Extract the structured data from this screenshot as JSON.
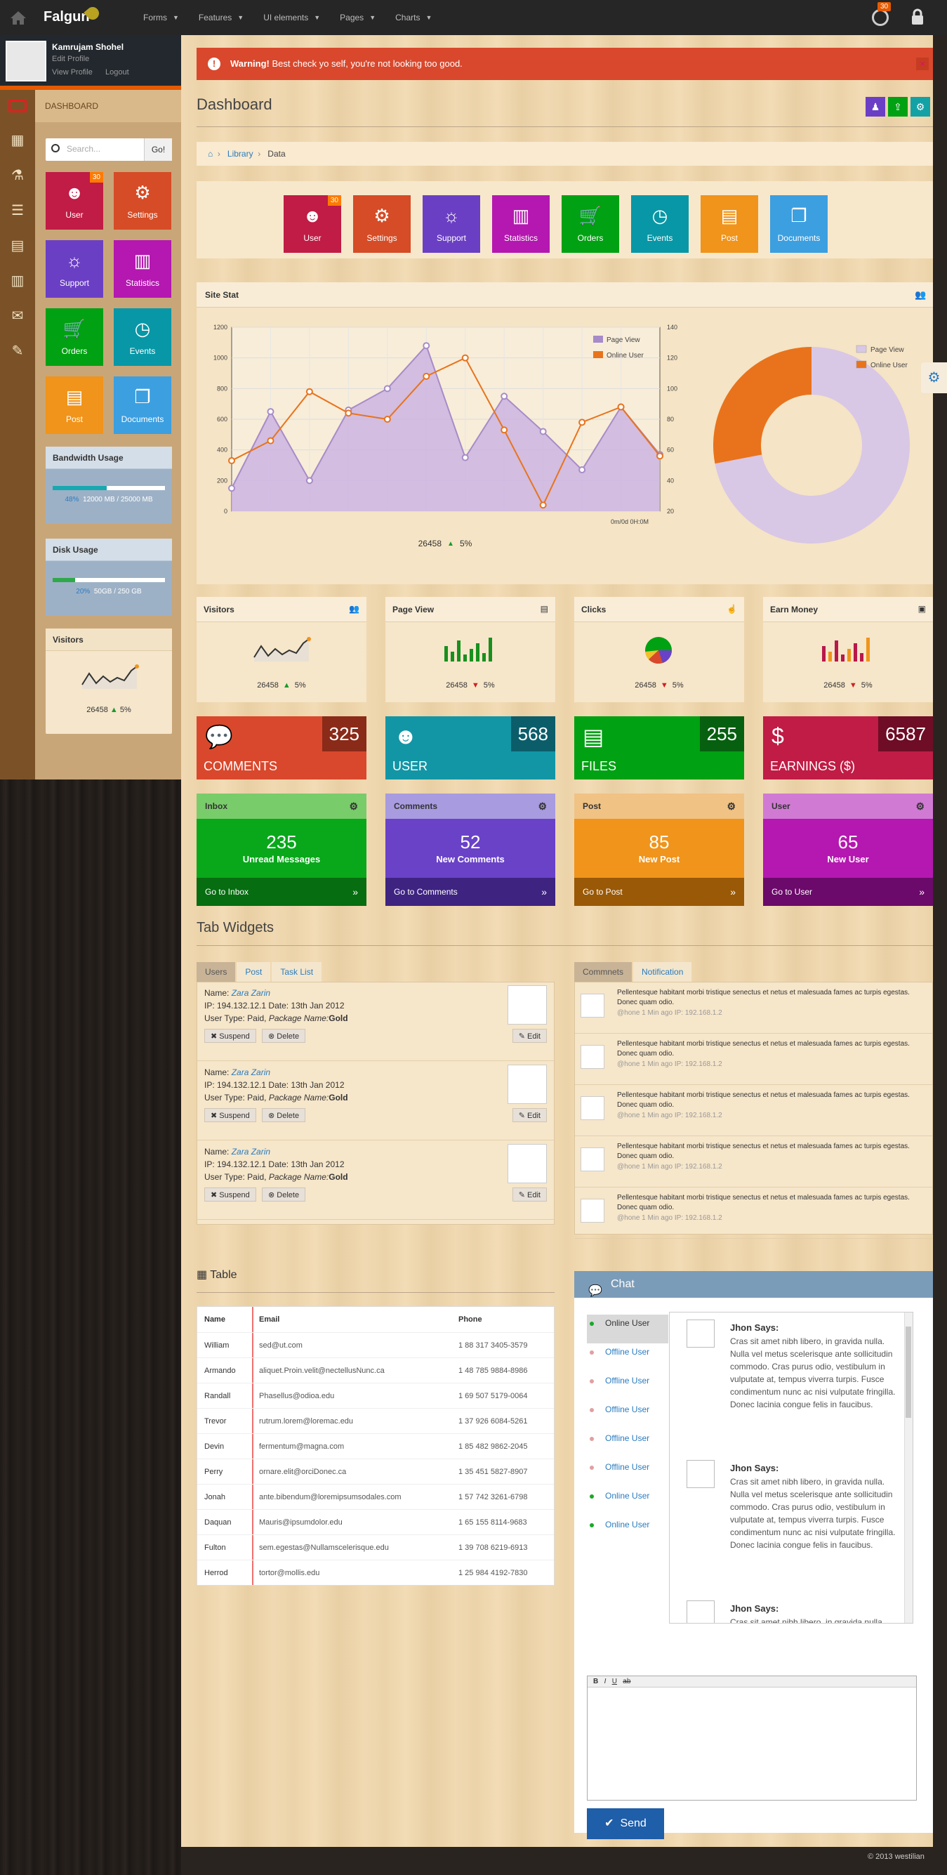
{
  "brand": "Falgun",
  "topnav": {
    "items": [
      "Forms",
      "Features",
      "UI elements",
      "Pages",
      "Charts"
    ],
    "notify_badge": "30"
  },
  "profile": {
    "name": "Kamrujam Shohel",
    "edit": "Edit Profile",
    "view": "View Profile",
    "logout": "Logout"
  },
  "sidebar": {
    "dashboard_label": "DASHBOARD",
    "search_placeholder": "Search...",
    "go": "Go!",
    "tiles": [
      {
        "label": "User",
        "badge": "30",
        "color": "#c01c45"
      },
      {
        "label": "Settings",
        "color": "#d54c26"
      },
      {
        "label": "Support",
        "color": "#6b3fc4"
      },
      {
        "label": "Statistics",
        "color": "#b418b0"
      },
      {
        "label": "Orders",
        "color": "#00a112"
      },
      {
        "label": "Events",
        "color": "#0897a6"
      },
      {
        "label": "Post",
        "color": "#f0941b"
      },
      {
        "label": "Documents",
        "color": "#3c9fe0"
      }
    ],
    "bandwidth": {
      "title": "Bandwidth Usage",
      "percent": "48%",
      "text": "12000 MB / 25000 MB",
      "fill": 0.48
    },
    "disk": {
      "title": "Disk Usage",
      "percent": "20%",
      "text": "50GB / 250 GB",
      "fill": 0.2
    },
    "visitors": {
      "title": "Visitors",
      "value": "26458",
      "pct": "5%"
    }
  },
  "warning": {
    "strong": "Warning!",
    "text": "Best check yo self, you're not looking too good."
  },
  "page_title": "Dashboard",
  "breadcrumb": {
    "library": "Library",
    "data": "Data"
  },
  "quick_tiles": [
    {
      "label": "User",
      "badge": "30",
      "color": "#c01c45"
    },
    {
      "label": "Settings",
      "color": "#d54c26"
    },
    {
      "label": "Support",
      "color": "#6b3fc4"
    },
    {
      "label": "Statistics",
      "color": "#b418b0"
    },
    {
      "label": "Orders",
      "color": "#00a112"
    },
    {
      "label": "Events",
      "color": "#0897a6"
    },
    {
      "label": "Post",
      "color": "#f0941b"
    },
    {
      "label": "Documents",
      "color": "#3c9fe0"
    }
  ],
  "site_stat": {
    "title": "Site Stat",
    "value": "26458",
    "pct": "5%",
    "xlabel": "0m/0d 0H:0M"
  },
  "chart_data": [
    {
      "type": "area",
      "title": "",
      "y_left_ticks": [
        0,
        200,
        400,
        600,
        800,
        1000,
        1200
      ],
      "y_right_ticks": [
        20,
        40,
        60,
        80,
        100,
        120,
        140
      ],
      "series": [
        {
          "name": "Page View",
          "color": "#a78bc8",
          "axis": "left",
          "values": [
            150,
            650,
            200,
            660,
            800,
            1080,
            350,
            750,
            520,
            270,
            680,
            370
          ]
        },
        {
          "name": "Online User",
          "color": "#e8731c",
          "axis": "right",
          "values": [
            53,
            66,
            98,
            84,
            80,
            108,
            120,
            73,
            24,
            78,
            88,
            56
          ]
        }
      ]
    },
    {
      "type": "pie",
      "donut": true,
      "series": [
        {
          "name": "Page View",
          "value": 72,
          "color": "#d9c7e6"
        },
        {
          "name": "Online User",
          "value": 28,
          "color": "#e8731c"
        }
      ]
    }
  ],
  "mini_stats": [
    {
      "title": "Visitors",
      "value": "26458",
      "pct": "5%",
      "dir": "up",
      "kind": "line"
    },
    {
      "title": "Page View",
      "value": "26458",
      "pct": "5%",
      "dir": "down",
      "kind": "bars-green"
    },
    {
      "title": "Clicks",
      "value": "26458",
      "pct": "5%",
      "dir": "down",
      "kind": "pie"
    },
    {
      "title": "Earn Money",
      "value": "26458",
      "pct": "5%",
      "dir": "down",
      "kind": "bars-red"
    }
  ],
  "big_stats": [
    {
      "label": "COMMENTS",
      "num": "325",
      "color": "#d9482c",
      "dark": "#8a2a18"
    },
    {
      "label": "USER",
      "num": "568",
      "color": "#1296a6",
      "dark": "#0b5d6a"
    },
    {
      "label": "FILES",
      "num": "255",
      "color": "#00a112",
      "dark": "#066010"
    },
    {
      "label": "EARNINGS ($)",
      "num": "6587",
      "color": "#c01c45",
      "dark": "#6e0d25"
    }
  ],
  "info_boxes": [
    {
      "title": "Inbox",
      "num": "235",
      "text": "Unread Messages",
      "link": "Go to Inbox",
      "head": "#79cc6a",
      "body": "#08a81a",
      "foot": "#066d10"
    },
    {
      "title": "Comments",
      "num": "52",
      "text": "New Comments",
      "link": "Go to Comments",
      "head": "#a89be0",
      "body": "#6a42c8",
      "foot": "#3e2381"
    },
    {
      "title": "Post",
      "num": "85",
      "text": "New Post",
      "link": "Go to Post",
      "head": "#f0c284",
      "body": "#f0941b",
      "foot": "#9a5906"
    },
    {
      "title": "User",
      "num": "65",
      "text": "New User",
      "link": "Go to User",
      "head": "#d17ad4",
      "body": "#b418b0",
      "foot": "#6b0a6a"
    }
  ],
  "tab_widgets": {
    "title": "Tab Widgets",
    "left_tabs": [
      "Users",
      "Post",
      "Task List"
    ],
    "right_tabs": [
      "Commnets",
      "Notification"
    ],
    "users": [
      {
        "name_label": "Name:",
        "name": "Zara Zarin",
        "ip": "IP: 194.132.12.1 Date: 13th Jan 2012",
        "type": "User Type: Paid,",
        "pkg": "Package Name:",
        "pkgv": "Gold"
      },
      {
        "name_label": "Name:",
        "name": "Zara Zarin",
        "ip": "IP: 194.132.12.1 Date: 13th Jan 2012",
        "type": "User Type: Paid,",
        "pkg": "Package Name:",
        "pkgv": "Gold"
      },
      {
        "name_label": "Name:",
        "name": "Zara Zarin",
        "ip": "IP: 194.132.12.1 Date: 13th Jan 2012",
        "type": "User Type: Paid,",
        "pkg": "Package Name:",
        "pkgv": "Gold"
      }
    ],
    "suspend": "Suspend",
    "delete": "Delete",
    "edit": "Edit",
    "comment_text": "Pellentesque habitant morbi tristique senectus et netus et malesuada fames ac turpis egestas. Donec quam odio.",
    "comment_meta": "@hone     1 Min ago     IP: 192.168.1.2"
  },
  "table": {
    "title": "Table",
    "headers": [
      "Name",
      "Email",
      "Phone"
    ],
    "rows": [
      [
        "William",
        "sed@ut.com",
        "1 88 317 3405-3579"
      ],
      [
        "Armando",
        "aliquet.Proin.velit@nectellusNunc.ca",
        "1 48 785 9884-8986"
      ],
      [
        "Randall",
        "Phasellus@odioa.edu",
        "1 69 507 5179-0064"
      ],
      [
        "Trevor",
        "rutrum.lorem@loremac.edu",
        "1 37 926 6084-5261"
      ],
      [
        "Devin",
        "fermentum@magna.com",
        "1 85 482 9862-2045"
      ],
      [
        "Perry",
        "ornare.elit@orciDonec.ca",
        "1 35 451 5827-8907"
      ],
      [
        "Jonah",
        "ante.bibendum@loremipsumsodales.com",
        "1 57 742 3261-6798"
      ],
      [
        "Daquan",
        "Mauris@ipsumdolor.edu",
        "1 65 155 8114-9683"
      ],
      [
        "Fulton",
        "sem.egestas@Nullamscelerisque.edu",
        "1 39 708 6219-6913"
      ],
      [
        "Herrod",
        "tortor@mollis.edu",
        "1 25 984 4192-7830"
      ]
    ]
  },
  "chat": {
    "title": "Chat",
    "users": [
      {
        "label": "Online User",
        "status": "online"
      },
      {
        "label": "Offline User",
        "status": "offline"
      },
      {
        "label": "Offline User",
        "status": "offline"
      },
      {
        "label": "Offline User",
        "status": "offline"
      },
      {
        "label": "Offline User",
        "status": "offline"
      },
      {
        "label": "Offline User",
        "status": "offline"
      },
      {
        "label": "Online User",
        "status": "online"
      },
      {
        "label": "Online User",
        "status": "online"
      }
    ],
    "messages": [
      {
        "who": "Jhon Says:",
        "text": "Cras sit amet nibh libero, in gravida nulla. Nulla vel metus scelerisque ante sollicitudin commodo. Cras purus odio, vestibulum in vulputate at, tempus viverra turpis. Fusce condimentum nunc ac nisi vulputate fringilla. Donec lacinia congue felis in faucibus."
      },
      {
        "who": "Jhon Says:",
        "text": "Cras sit amet nibh libero, in gravida nulla. Nulla vel metus scelerisque ante sollicitudin commodo. Cras purus odio, vestibulum in vulputate at, tempus viverra turpis. Fusce condimentum nunc ac nisi vulputate fringilla. Donec lacinia congue felis in faucibus."
      },
      {
        "who": "Jhon Says:",
        "text": "Cras sit amet nibh libero, in gravida nulla. Nulla vel metus scelerisque ante sollicitudin commodo."
      }
    ],
    "send": "Send"
  },
  "footer": "© 2013 westilian"
}
